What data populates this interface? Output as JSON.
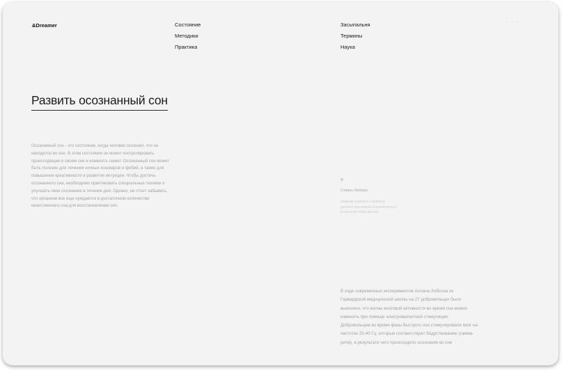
{
  "brand": {
    "logo": "&Dreamer"
  },
  "nav": {
    "column1": [
      "Состояние",
      "Методики",
      "Практика"
    ],
    "column2": [
      "Засыпальня",
      "Термины",
      "Наука"
    ],
    "more": "· · ·"
  },
  "page_title": "Развить осознанный сон",
  "intro_text": "Осознанный сон - это состояние, когда человек осознает, что он находится во сне. В этом состоянии он может контролировать происходящее в своем сне и изменять сюжет. Осознанный сон может быть полезен для лечения ночных кошмаров и фобий, а также для повышения креативности и развития интуиции. Чтобы достичь осознанного сна, необходимо практиковать специальные техники и улучшать свое осознание в течение дня. Однако, не стоит забывать, что организм все еще нуждается в достаточном количестве качественного сна для восстановления сил.",
  "quote": {
    "author": "Стивен Лаберж",
    "text": "первым подошёл к вопросу данного феномена исключительно в научной точки зрения"
  },
  "research_text": "В ходе современных экспериментов Аллана Хобсона из Гарвардской медицинской школы на 27 добровольцах было выяснено, что волны мозговой активности во время сна можно изменить при помощи электромагнитной стимуляции. Добровольцам во время фазы быстрого сна стимулировали мозг на частотах 25-40 Гц, которые соответствуют бодрствованию (гамма-ритм), в результате чего происходило осознание во сне"
}
